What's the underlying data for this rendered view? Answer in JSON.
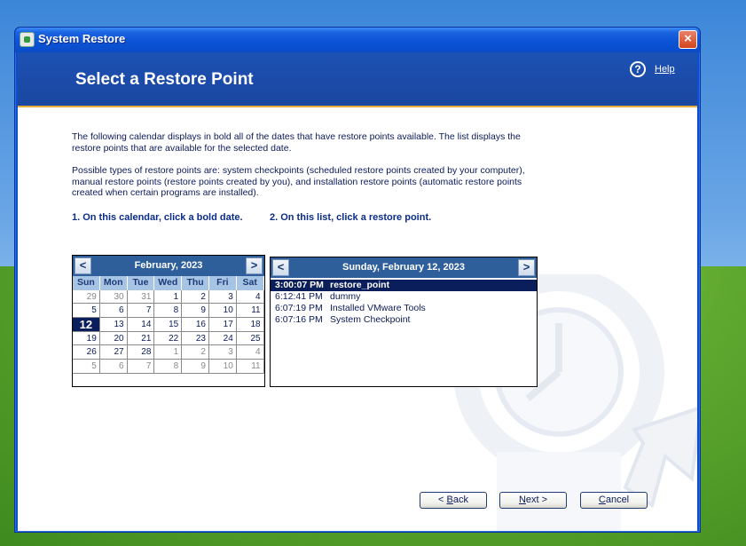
{
  "window": {
    "title": "System Restore",
    "close_glyph": "×"
  },
  "header": {
    "title": "Select a Restore Point",
    "help_icon": "?",
    "help_label": "Help"
  },
  "intro": {
    "paragraph1": "The following calendar displays in bold all of the dates that have restore points available. The list displays the restore points that are available for the selected date.",
    "paragraph2": "Possible types of restore points are: system checkpoints (scheduled restore points created by your computer), manual restore points (restore points created by you), and installation restore points (automatic restore points created when certain programs are installed)."
  },
  "steps": {
    "step1": "1. On this calendar, click a bold date.",
    "step2": "2. On this list, click a restore point."
  },
  "calendar": {
    "prev": "<",
    "next": ">",
    "month": "February, 2023",
    "weekdays": [
      "Sun",
      "Mon",
      "Tue",
      "Wed",
      "Thu",
      "Fri",
      "Sat"
    ],
    "weeks": [
      [
        "29",
        "30",
        "31",
        "1",
        "2",
        "3",
        "4"
      ],
      [
        "5",
        "6",
        "7",
        "8",
        "9",
        "10",
        "11"
      ],
      [
        "12",
        "13",
        "14",
        "15",
        "16",
        "17",
        "18"
      ],
      [
        "19",
        "20",
        "21",
        "22",
        "23",
        "24",
        "25"
      ],
      [
        "26",
        "27",
        "28",
        "1",
        "2",
        "3",
        "4"
      ],
      [
        "5",
        "6",
        "7",
        "8",
        "9",
        "10",
        "11"
      ]
    ],
    "selected": "12"
  },
  "restore_list": {
    "prev": "<",
    "next": ">",
    "date": "Sunday, February 12, 2023",
    "items": [
      {
        "time": "3:00:07 PM",
        "name": "restore_point",
        "selected": true
      },
      {
        "time": "6:12:41 PM",
        "name": "dummy",
        "selected": false
      },
      {
        "time": "6:07:19 PM",
        "name": "Installed VMware Tools",
        "selected": false
      },
      {
        "time": "6:07:16 PM",
        "name": "System Checkpoint",
        "selected": false
      }
    ]
  },
  "buttons": {
    "back_pre": "< ",
    "back_ul": "B",
    "back_post": "ack",
    "next_ul": "N",
    "next_post": "ext >",
    "cancel_ul": "C",
    "cancel_post": "ancel"
  }
}
